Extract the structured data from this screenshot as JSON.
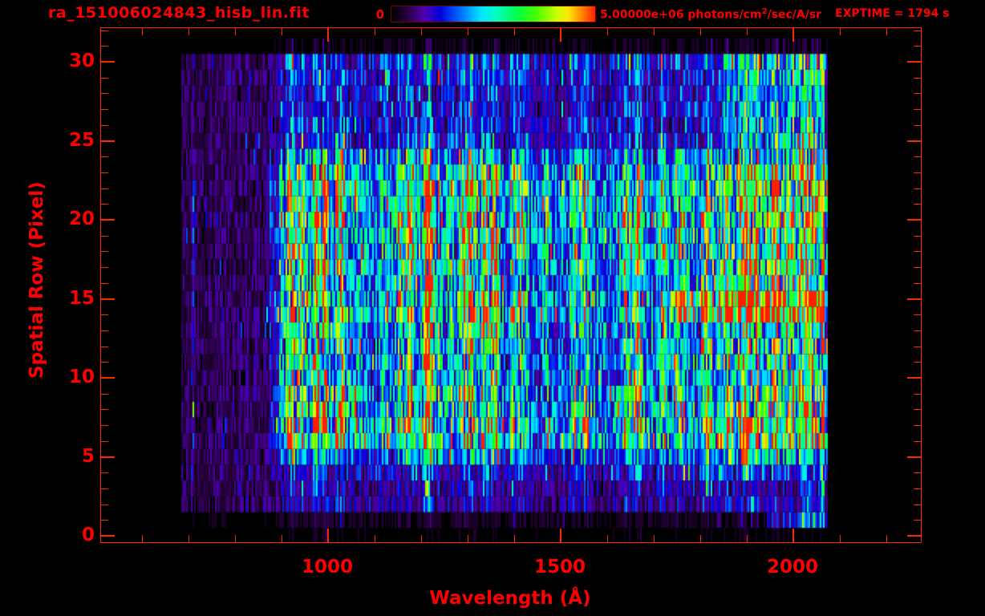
{
  "header": {
    "title": "ra_151006024843_hisb_lin.fit",
    "colorbar_min_label": "0",
    "colorbar_units_pre": "5.00000e+06 photons/cm",
    "colorbar_units_sup": "2",
    "colorbar_units_post": "/sec/A/sr",
    "exptime": "EXPTIME = 1794 s"
  },
  "chart_data": {
    "type": "heatmap",
    "title": "ra_151006024843_hisb_lin.fit",
    "xlabel": "Wavelength (Å)",
    "ylabel": "Spatial Row (Pixel)",
    "exposure_time_s": 1794,
    "xlim": [
      512,
      2274
    ],
    "ylim": [
      -0.4,
      32.6
    ],
    "x_tick_labels": [
      "1000",
      "1500",
      "2000"
    ],
    "x_ticks_major": [
      1000,
      1500,
      2000
    ],
    "x_ticks_minor": [
      600,
      700,
      800,
      900,
      1100,
      1200,
      1300,
      1400,
      1600,
      1700,
      1800,
      1900,
      2100,
      2200
    ],
    "y_tick_labels": [
      "0",
      "5",
      "10",
      "15",
      "20",
      "25",
      "30"
    ],
    "y_ticks_major": [
      0,
      5,
      10,
      15,
      20,
      25,
      30
    ],
    "y_ticks_minor_step": 1,
    "grid": false,
    "colorbar": {
      "min": 0,
      "max": 5000000,
      "max_label": "5.00000e+06 photons/cm2/sec/A/sr",
      "min_label": "0",
      "stops": [
        [
          0.0,
          "#000000"
        ],
        [
          0.08,
          "#280040"
        ],
        [
          0.16,
          "#5000b0"
        ],
        [
          0.24,
          "#0000dc"
        ],
        [
          0.34,
          "#006eff"
        ],
        [
          0.44,
          "#00e6ff"
        ],
        [
          0.52,
          "#00ffbe"
        ],
        [
          0.62,
          "#00ff46"
        ],
        [
          0.71,
          "#46ff00"
        ],
        [
          0.81,
          "#c8ff00"
        ],
        [
          0.87,
          "#ffe600"
        ],
        [
          0.93,
          "#ff8c00"
        ],
        [
          1.0,
          "#ff1e00"
        ]
      ]
    },
    "data_wavelength_range": [
      683,
      2074
    ],
    "n_rows": 32,
    "row_profile": [
      0.03,
      0.05,
      0.16,
      0.18,
      0.3,
      0.55,
      0.95,
      1.0,
      0.95,
      0.85,
      0.72,
      0.78,
      0.72,
      0.78,
      1.0,
      1.0,
      0.8,
      0.92,
      0.95,
      0.9,
      1.0,
      0.95,
      1.0,
      0.88,
      0.6,
      0.3,
      0.27,
      0.3,
      0.27,
      0.32,
      0.38,
      0.05
    ],
    "row_envelope": [
      0.1,
      0.3,
      1,
      1,
      1,
      1,
      1,
      1,
      1,
      1,
      1,
      1,
      1,
      1,
      1,
      1,
      1,
      1,
      1,
      1,
      1,
      1,
      1,
      1,
      1,
      1,
      1,
      1,
      1,
      1,
      1,
      0.2
    ],
    "noise_floor": 0.1,
    "continuum": [
      [
        683,
        0.1
      ],
      [
        860,
        0.11
      ],
      [
        900,
        0.44
      ],
      [
        1000,
        0.48
      ],
      [
        1050,
        0.44
      ],
      [
        1100,
        0.42
      ],
      [
        1150,
        0.44
      ],
      [
        1250,
        0.42
      ],
      [
        1300,
        0.44
      ],
      [
        1380,
        0.42
      ],
      [
        1450,
        0.38
      ],
      [
        1550,
        0.4
      ],
      [
        1650,
        0.42
      ],
      [
        1750,
        0.46
      ],
      [
        1850,
        0.54
      ],
      [
        1950,
        0.58
      ],
      [
        2030,
        0.6
      ],
      [
        2060,
        0.56
      ],
      [
        2074,
        0.35
      ]
    ],
    "emission_lines": [
      {
        "wavelength": 916,
        "amp": 0.3,
        "width": 7
      },
      {
        "wavelength": 926,
        "amp": 0.38,
        "width": 7
      },
      {
        "wavelength": 938,
        "amp": 0.3,
        "width": 6
      },
      {
        "wavelength": 950,
        "amp": 0.42,
        "width": 7
      },
      {
        "wavelength": 973,
        "amp": 0.45,
        "width": 7
      },
      {
        "wavelength": 991,
        "amp": 0.42,
        "width": 7
      },
      {
        "wavelength": 1026,
        "amp": 0.6,
        "width": 8
      },
      {
        "wavelength": 1060,
        "amp": 0.18,
        "width": 8
      },
      {
        "wavelength": 1122,
        "amp": 0.25,
        "width": 8
      },
      {
        "wavelength": 1152,
        "amp": 0.4,
        "width": 9
      },
      {
        "wavelength": 1176,
        "amp": 0.45,
        "width": 8
      },
      {
        "wavelength": 1207,
        "amp": 0.85,
        "width": 7
      },
      {
        "wavelength": 1218,
        "amp": 0.75,
        "width": 9
      },
      {
        "wavelength": 1240,
        "amp": 0.28,
        "width": 8
      },
      {
        "wavelength": 1260,
        "amp": 0.22,
        "width": 8
      },
      {
        "wavelength": 1294,
        "amp": 0.42,
        "width": 9
      },
      {
        "wavelength": 1306,
        "amp": 0.48,
        "width": 8
      },
      {
        "wavelength": 1335,
        "amp": 0.42,
        "width": 8
      },
      {
        "wavelength": 1356,
        "amp": 0.5,
        "width": 9
      },
      {
        "wavelength": 1400,
        "amp": 0.3,
        "width": 10
      },
      {
        "wavelength": 1417,
        "amp": 0.25,
        "width": 8
      },
      {
        "wavelength": 1470,
        "amp": 0.22,
        "width": 10
      },
      {
        "wavelength": 1530,
        "amp": 0.25,
        "width": 8
      },
      {
        "wavelength": 1550,
        "amp": 0.4,
        "width": 9
      },
      {
        "wavelength": 1640,
        "amp": 0.42,
        "width": 8
      },
      {
        "wavelength": 1665,
        "amp": 0.5,
        "width": 9
      },
      {
        "wavelength": 1720,
        "amp": 0.2,
        "width": 8
      },
      {
        "wavelength": 1755,
        "amp": 0.25,
        "width": 9
      },
      {
        "wavelength": 1815,
        "amp": 0.25,
        "width": 10
      },
      {
        "wavelength": 1855,
        "amp": 0.3,
        "width": 10
      },
      {
        "wavelength": 1892,
        "amp": 0.35,
        "width": 10
      },
      {
        "wavelength": 1920,
        "amp": 0.3,
        "width": 12
      },
      {
        "wavelength": 1958,
        "amp": 0.35,
        "width": 12
      },
      {
        "wavelength": 1995,
        "amp": 0.3,
        "width": 12
      },
      {
        "wavelength": 2025,
        "amp": 0.35,
        "width": 12
      },
      {
        "wavelength": 2045,
        "amp": 0.3,
        "width": 10
      }
    ],
    "flat_lines": [
      {
        "wavelength": 710,
        "amp": 0.24,
        "width": 5,
        "rows": [
          1.5,
          30.5
        ]
      },
      {
        "wavelength": 2063,
        "amp": 1.0,
        "width": 6,
        "rows": [
          0.5,
          30.5
        ]
      }
    ],
    "bands": [
      {
        "rows": [
          13.5,
          15.8
        ],
        "from": 1730,
        "to": 2068,
        "boost": 0.5
      },
      {
        "rows": [
          24.5,
          30.5
        ],
        "from": 1850,
        "to": 2065,
        "boost": 0.22
      },
      {
        "rows": [
          0.5,
          1.6
        ],
        "from": 1940,
        "to": 2060,
        "boost": 0.25
      },
      {
        "rows": [
          5.5,
          9.5
        ],
        "from": 905,
        "to": 1060,
        "boost": 0.1
      }
    ]
  },
  "colors": {
    "text": "#ff0000",
    "frame": "#ff2600",
    "background": "#000000"
  }
}
